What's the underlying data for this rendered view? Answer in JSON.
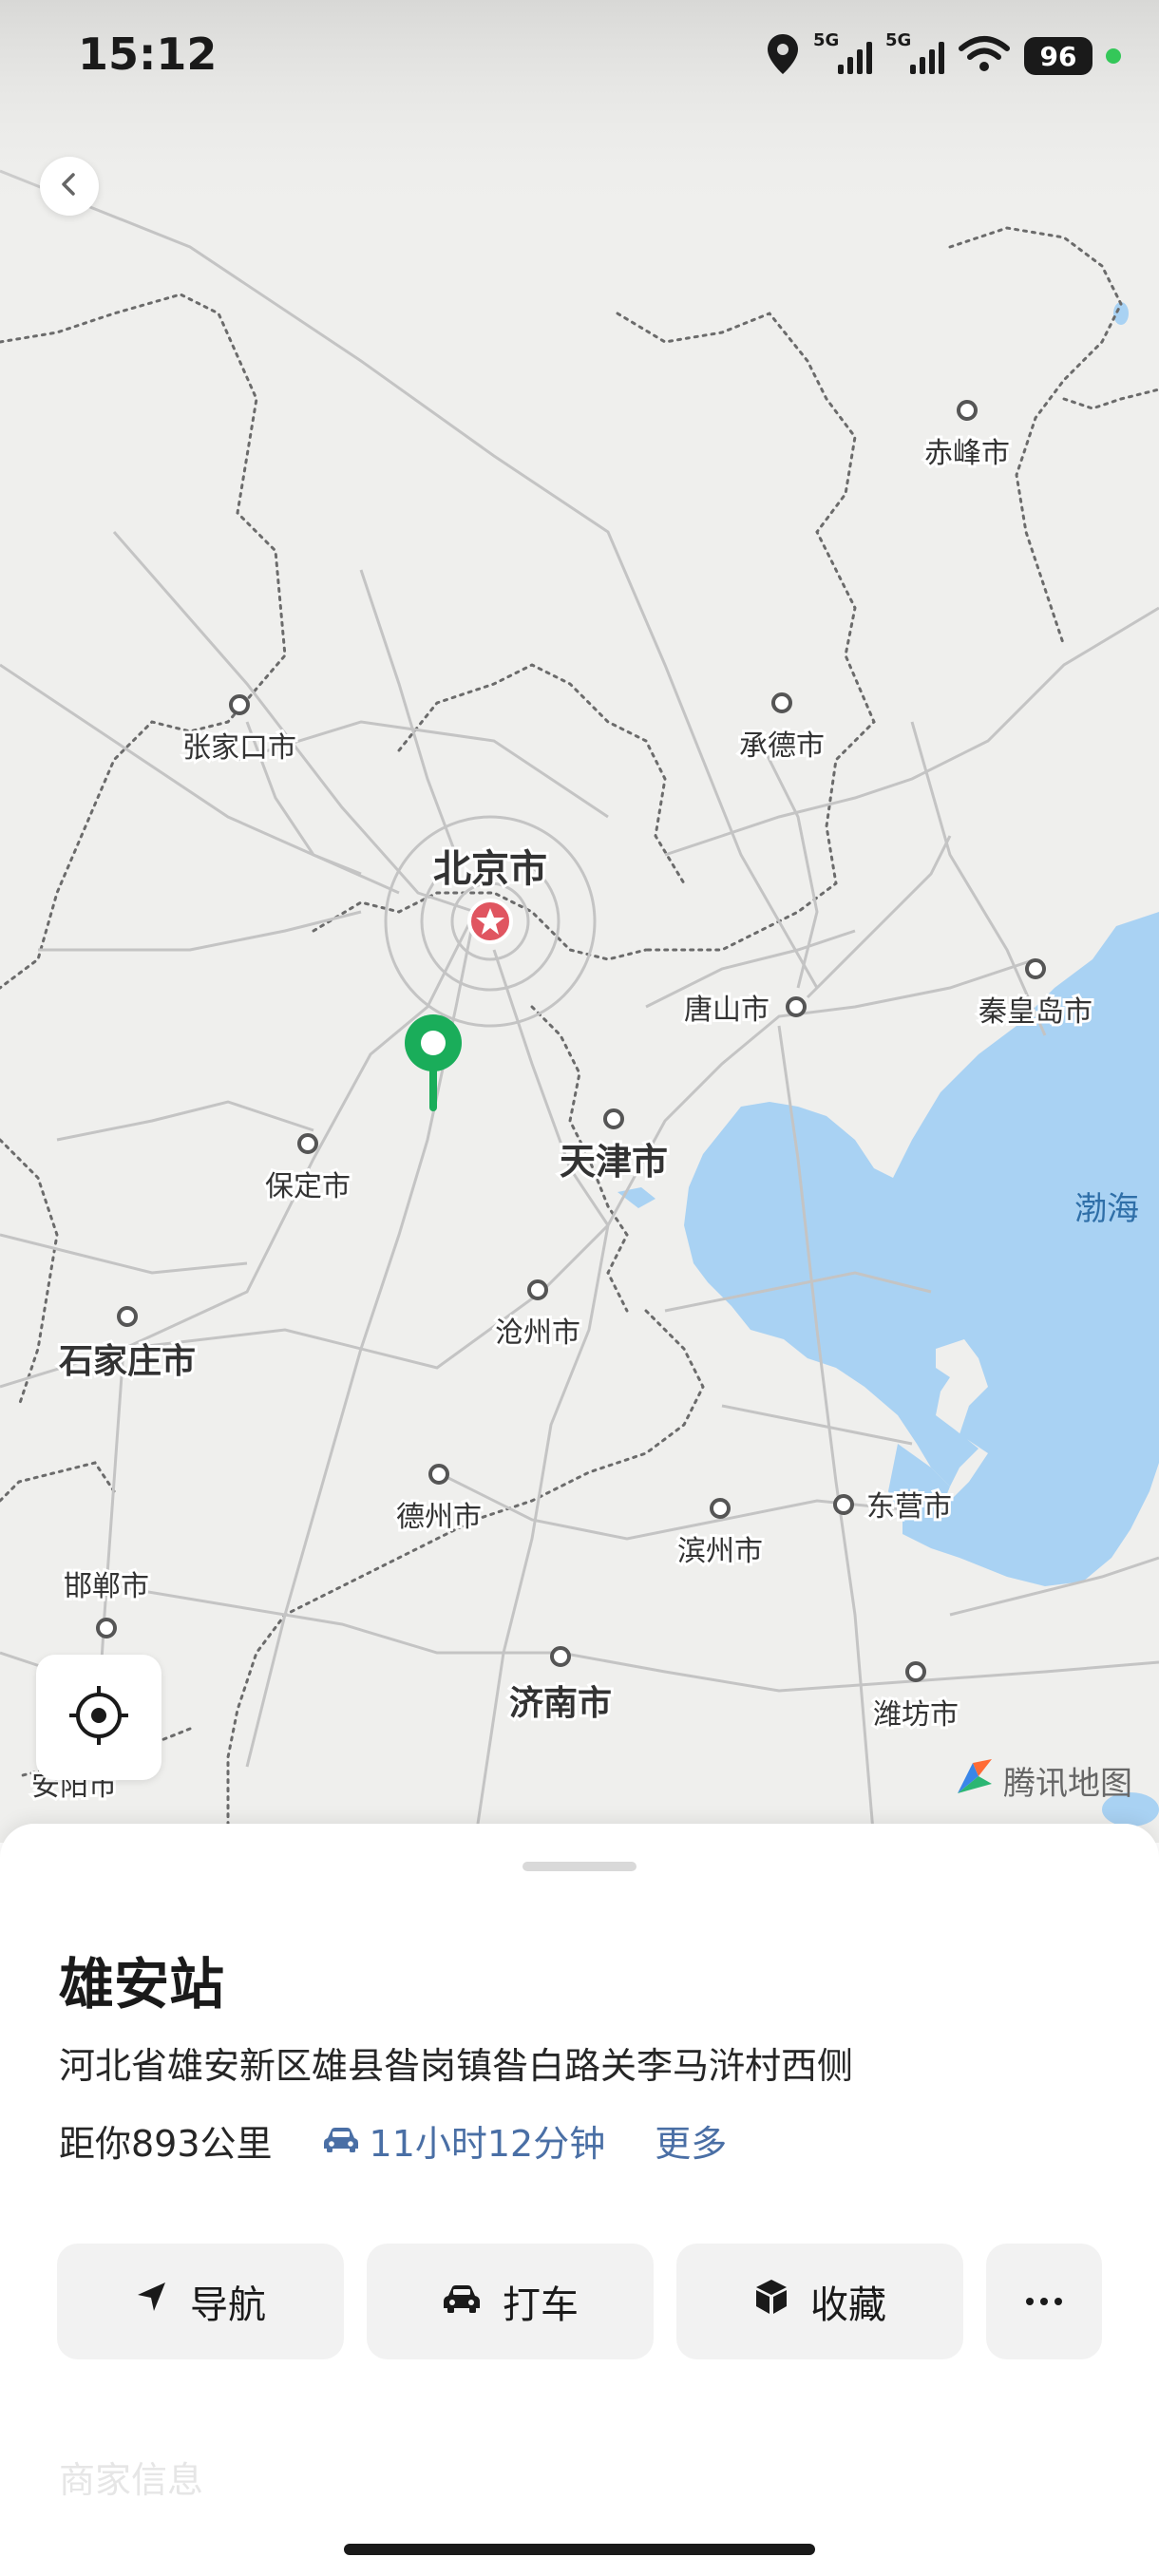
{
  "status_bar": {
    "time": "15:12",
    "network_1": "5G",
    "network_2": "5G",
    "battery": "96",
    "icons": [
      "location-icon",
      "signal-icon",
      "signal-icon",
      "wifi-icon",
      "battery-icon"
    ]
  },
  "map": {
    "cities": [
      "赤峰市",
      "张家口市",
      "承德市",
      "北京市",
      "唐山市",
      "秦皇岛市",
      "保定市",
      "天津市",
      "沧州市",
      "石家庄市",
      "德州市",
      "滨州市",
      "东营市",
      "邯郸市",
      "济南市",
      "潍坊市",
      "安阳市"
    ],
    "sea_label": "渤海",
    "watermark": "腾讯地图",
    "colors": {
      "land": "#efefed",
      "sea": "#a9d2f3",
      "pin": "#1aad5a",
      "capital_marker": "#e05560"
    }
  },
  "place": {
    "name": "雄安站",
    "address": "河北省雄安新区雄县昝岗镇昝白路关李马浒村西侧",
    "distance": "距你893公里",
    "drive_time": "11小时12分钟",
    "more_label": "更多"
  },
  "actions": {
    "navigate": "导航",
    "taxi": "打车",
    "favorite": "收藏"
  },
  "section_title": "商家信息"
}
